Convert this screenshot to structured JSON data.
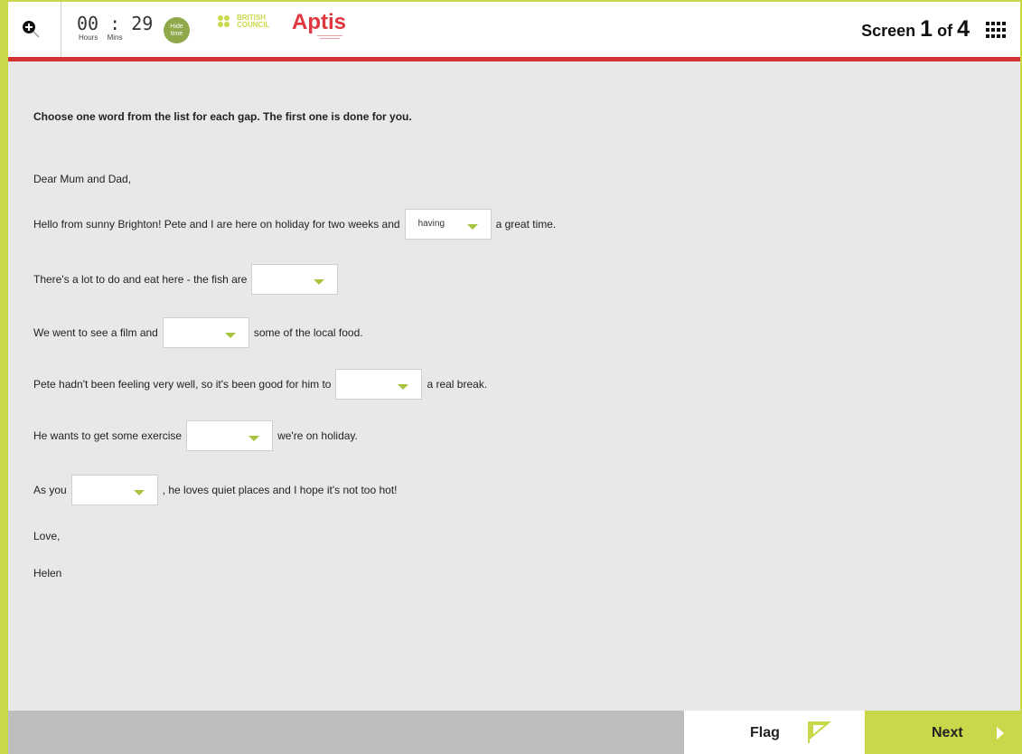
{
  "header": {
    "zoom_icon": "zoom-in-icon",
    "timer": {
      "value": "00 : 29",
      "hours_label": "Hours",
      "mins_label": "Mins"
    },
    "hide_time_label": "Hide time",
    "logo": {
      "org_line1": "BRITISH",
      "org_line2": "COUNCIL",
      "product": "Aptis"
    },
    "screen": {
      "prefix": "Screen",
      "current": "1",
      "of": "of",
      "total": "4"
    },
    "grid_icon": "grid-menu-icon"
  },
  "task": {
    "instructions": "Choose one word from the list for each gap. The first one is done for you.",
    "salutation": "Dear Mum and Dad,",
    "lines": [
      {
        "before": "Hello from sunny Brighton! Pete and I are here on holiday for two weeks and",
        "value": "having",
        "after": "a great time."
      },
      {
        "before": "There's a lot to do and eat here - the fish are",
        "value": "",
        "after": ""
      },
      {
        "before": "We went to see a film and",
        "value": "",
        "after": "some of the local food."
      },
      {
        "before": "Pete hadn't been feeling very well, so it's been good for him to",
        "value": "",
        "after": "a real break."
      },
      {
        "before": "He wants to get some exercise",
        "value": "",
        "after": "we're on holiday."
      },
      {
        "before": "As you",
        "value": "",
        "after": ", he loves quiet places and I hope it's not too hot!"
      }
    ],
    "closing": "Love,",
    "signature": "Helen"
  },
  "footer": {
    "flag_label": "Flag",
    "flag_icon": "flag-icon",
    "next_label": "Next",
    "next_icon": "chevron-right-icon"
  },
  "colors": {
    "accent_green": "#c9d84a",
    "header_red": "#d23232",
    "brand_red": "#e0363e",
    "background": "#e8e8e8",
    "footer_gray": "#bdbdbd"
  }
}
